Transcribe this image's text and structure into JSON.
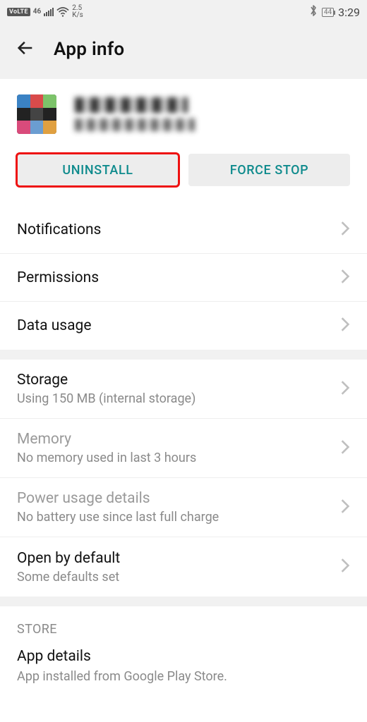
{
  "status": {
    "volte": "VoLTE",
    "net_gen": "46",
    "speed_top": "2.5",
    "speed_bot": "K/s",
    "battery": "44",
    "time": "3:29"
  },
  "header": {
    "title": "App info"
  },
  "buttons": {
    "uninstall": "UNINSTALL",
    "forcestop": "FORCE STOP"
  },
  "rows": {
    "notifications": "Notifications",
    "permissions": "Permissions",
    "datausage": "Data usage",
    "storage_t": "Storage",
    "storage_s": "Using 150 MB (internal storage)",
    "memory_t": "Memory",
    "memory_s": "No memory used in last 3 hours",
    "power_t": "Power usage details",
    "power_s": "No battery use since last full charge",
    "open_t": "Open by default",
    "open_s": "Some defaults set"
  },
  "store": {
    "header": "STORE",
    "details_t": "App details",
    "details_s": "App installed from Google Play Store."
  }
}
